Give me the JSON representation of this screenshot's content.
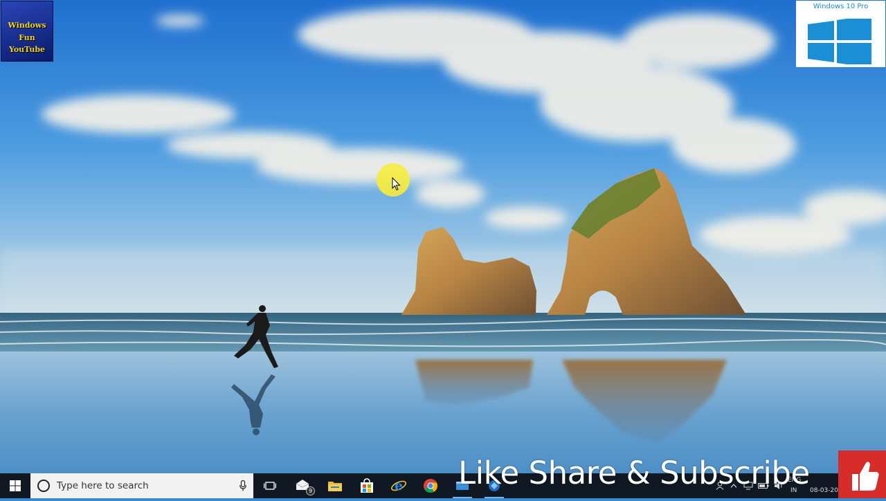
{
  "overlay": {
    "channel_logo": [
      "Windows",
      "Fun",
      "YouTube"
    ],
    "badge_title": "Windows 10 Pro",
    "subscribe_text": "Like Share & Subscribe",
    "like_icon": "thumbs-up-icon"
  },
  "taskbar": {
    "start_icon": "windows-start-icon",
    "search_placeholder": "Type here to search",
    "mail_badge": "9",
    "icons": [
      "microphone-icon",
      "task-view-icon",
      "mail-icon",
      "file-explorer-icon",
      "store-icon",
      "internet-explorer-icon",
      "chrome-icon"
    ],
    "tray": {
      "language_top": "ENG",
      "language_bottom": "IN",
      "date": "08-03-20"
    }
  },
  "colors": {
    "taskbar_bg": "#101823",
    "search_bg": "#f2f2f2",
    "accent_blue": "#1a8fd6",
    "like_red": "#d62c2a",
    "cursor_highlight": "#f6ec3c"
  }
}
